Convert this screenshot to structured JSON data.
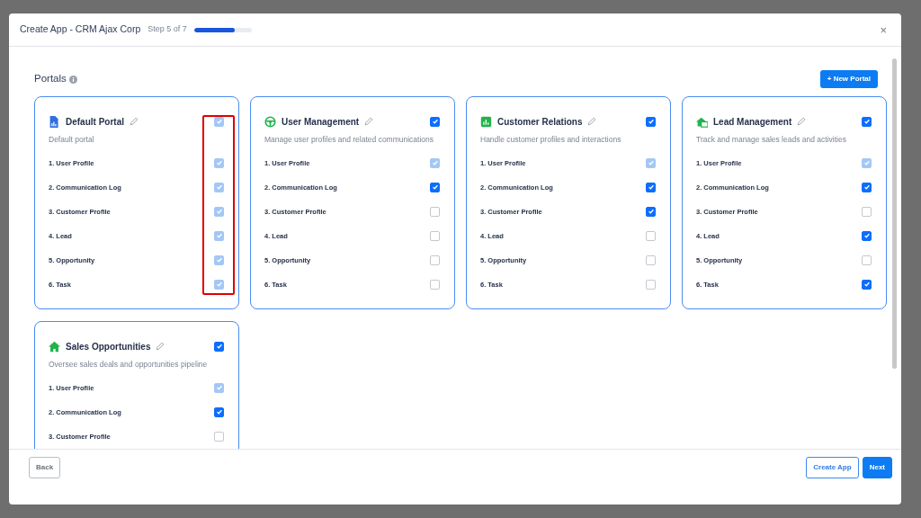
{
  "dialog": {
    "title": "Create App  - CRM Ajax Corp",
    "step": "Step 5 of 7",
    "progress": {
      "level": 0.71
    },
    "close": "×"
  },
  "section": {
    "title": "Portals",
    "new_button": "+ New Portal"
  },
  "portals": [
    {
      "kind": "document-chart",
      "name": "Default Portal",
      "description": "Default portal",
      "checked": true,
      "disabled": true,
      "highlighted": true,
      "items": [
        {
          "label": "1. User Profile",
          "checked": true,
          "disabled": true
        },
        {
          "label": "2. Communication Log",
          "checked": true,
          "disabled": true
        },
        {
          "label": "3. Customer Profile",
          "checked": true,
          "disabled": true
        },
        {
          "label": "4. Lead",
          "checked": true,
          "disabled": true
        },
        {
          "label": "5. Opportunity",
          "checked": true,
          "disabled": true
        },
        {
          "label": "6. Task",
          "checked": true,
          "disabled": true
        }
      ]
    },
    {
      "kind": "steering-wheel",
      "name": "User Management",
      "description": "Manage user profiles and related communications",
      "checked": true,
      "disabled": false,
      "highlighted": false,
      "items": [
        {
          "label": "1. User Profile",
          "checked": true,
          "disabled": true
        },
        {
          "label": "2. Communication Log",
          "checked": true,
          "disabled": false
        },
        {
          "label": "3. Customer Profile",
          "checked": false,
          "disabled": false
        },
        {
          "label": "4. Lead",
          "checked": false,
          "disabled": false
        },
        {
          "label": "5. Opportunity",
          "checked": false,
          "disabled": false
        },
        {
          "label": "6. Task",
          "checked": false,
          "disabled": false
        }
      ]
    },
    {
      "kind": "bar-chart",
      "name": "Customer Relations",
      "description": "Handle customer profiles and interactions",
      "checked": true,
      "disabled": false,
      "highlighted": false,
      "items": [
        {
          "label": "1. User Profile",
          "checked": true,
          "disabled": true
        },
        {
          "label": "2. Communication Log",
          "checked": true,
          "disabled": false
        },
        {
          "label": "3. Customer Profile",
          "checked": true,
          "disabled": false
        },
        {
          "label": "4. Lead",
          "checked": false,
          "disabled": false
        },
        {
          "label": "5. Opportunity",
          "checked": false,
          "disabled": false
        },
        {
          "label": "6. Task",
          "checked": false,
          "disabled": false
        }
      ]
    },
    {
      "kind": "house-screen",
      "name": "Lead Management",
      "description": "Track and manage sales leads and activities",
      "checked": true,
      "disabled": false,
      "highlighted": false,
      "items": [
        {
          "label": "1. User Profile",
          "checked": true,
          "disabled": true
        },
        {
          "label": "2. Communication Log",
          "checked": true,
          "disabled": false
        },
        {
          "label": "3. Customer Profile",
          "checked": false,
          "disabled": false
        },
        {
          "label": "4. Lead",
          "checked": true,
          "disabled": false
        },
        {
          "label": "5. Opportunity",
          "checked": false,
          "disabled": false
        },
        {
          "label": "6. Task",
          "checked": true,
          "disabled": false
        }
      ]
    },
    {
      "kind": "house",
      "name": "Sales Opportunities",
      "description": "Oversee sales deals and opportunities pipeline",
      "checked": true,
      "disabled": false,
      "highlighted": false,
      "items": [
        {
          "label": "1. User Profile",
          "checked": true,
          "disabled": true
        },
        {
          "label": "2. Communication Log",
          "checked": true,
          "disabled": false
        },
        {
          "label": "3. Customer Profile",
          "checked": false,
          "disabled": false
        }
      ]
    }
  ],
  "footer": {
    "back": "Back",
    "create": "Create App",
    "next": "Next"
  }
}
